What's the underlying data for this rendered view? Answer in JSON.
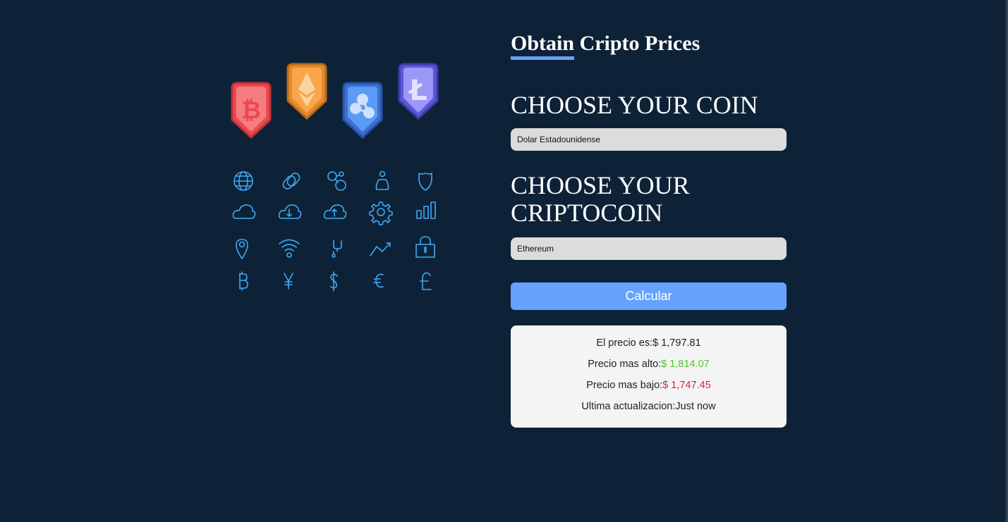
{
  "header": {
    "title": "Obtain Cripto Prices"
  },
  "form": {
    "coin_heading": "CHOOSE YOUR COIN",
    "coin_selected": "Dolar Estadounidense",
    "crypto_heading": "CHOOSE YOUR CRIPTOCOIN",
    "crypto_selected": "Ethereum",
    "submit_label": "Calcular"
  },
  "result": {
    "price_label": "El precio es:",
    "price_value": "$ 1,797.81",
    "high_label": "Precio mas alto:",
    "high_value": "$ 1,814.07",
    "low_label": "Precio mas bajo:",
    "low_value": "$ 1,747.45",
    "updated_label": "Ultima actualizacion:",
    "updated_value": "Just now"
  },
  "illustration": {
    "tokens": [
      "bitcoin-icon",
      "ethereum-icon",
      "ripple-icon",
      "litecoin-icon"
    ],
    "icon_grid": [
      "globe-icon",
      "link-icon",
      "network-icon",
      "money-bag-icon",
      "shield-icon",
      "cloud-icon",
      "cloud-download-icon",
      "cloud-upload-icon",
      "gear-icon",
      "bar-chart-icon",
      "location-pin-icon",
      "wifi-icon",
      "usb-icon",
      "trend-up-icon",
      "lock-icon",
      "bitcoin-symbol-icon",
      "yen-icon",
      "dollar-icon",
      "euro-icon",
      "pound-icon"
    ]
  },
  "colors": {
    "background": "#0e2237",
    "accent": "#66a2fe",
    "icon_stroke": "#3fa9f5",
    "high_price": "#4fc332",
    "low_price": "#e0213d"
  }
}
